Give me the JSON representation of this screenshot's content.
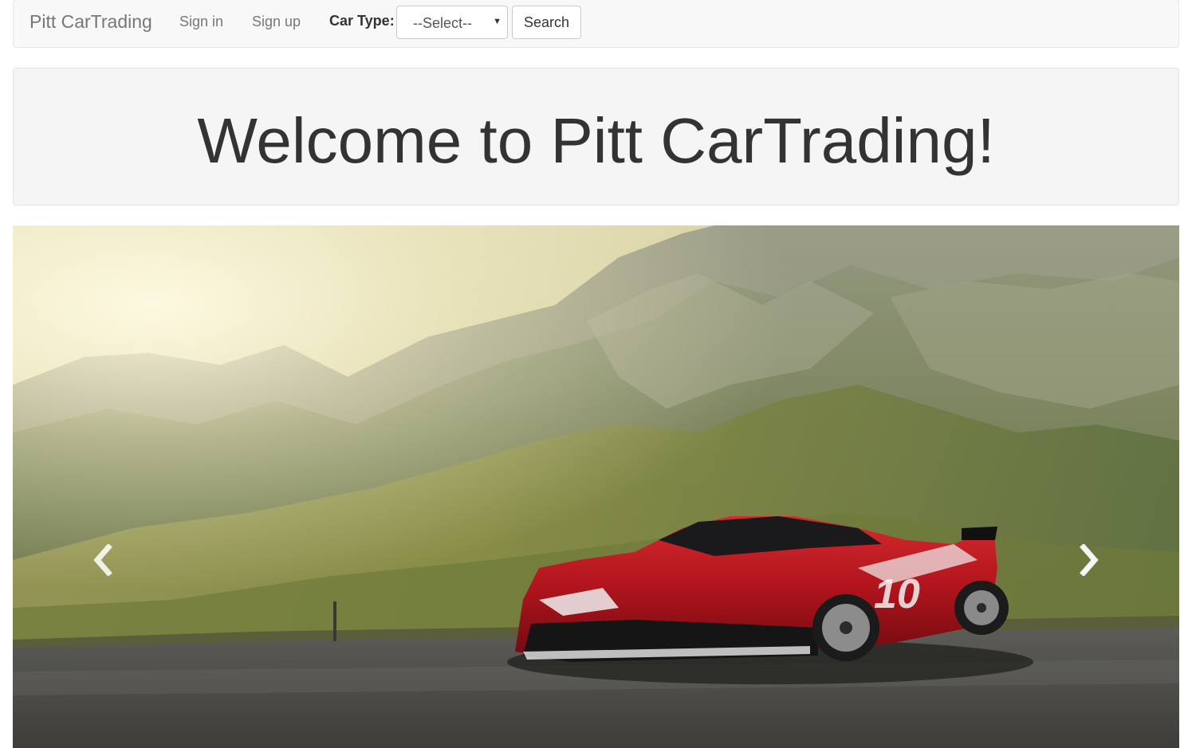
{
  "navbar": {
    "brand": "Pitt CarTrading",
    "links": [
      {
        "label": "Sign in"
      },
      {
        "label": "Sign up"
      }
    ],
    "car_type_label": "Car Type:",
    "car_type_select": {
      "selected": "--Select--"
    },
    "search_label": "Search"
  },
  "jumbotron": {
    "title": "Welcome to Pitt CarTrading!"
  },
  "carousel": {
    "slide_image": "red-sports-car-mountain-road",
    "prev_icon": "chevron-left-icon",
    "next_icon": "chevron-right-icon",
    "car_number": "10"
  },
  "colors": {
    "navbar_bg": "#f8f8f8",
    "jumbotron_bg": "#f5f5f5",
    "link_color": "#777777",
    "text_color": "#333333",
    "car_red": "#b0141c"
  }
}
